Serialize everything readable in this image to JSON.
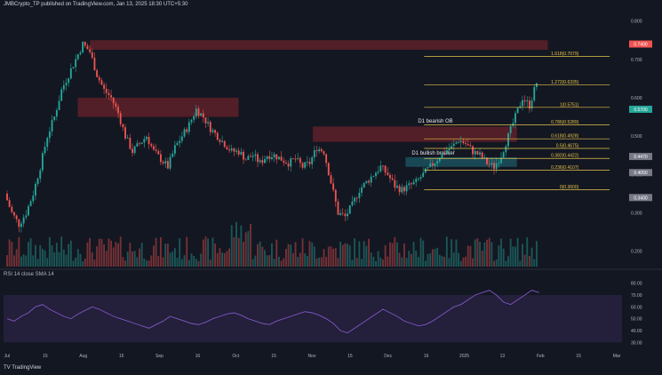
{
  "header": {
    "publisher": "JMBCrypto_TP published on TradingView.com, Jan 13, 2025 18:30 UTC+5:30",
    "line2": "RSI 14 close SMA 14"
  },
  "footer": {
    "logo_text": "TV TradingView"
  },
  "colors": {
    "bg": "#131722",
    "up": "#26a69a",
    "down": "#ef5350",
    "bear_zone": "#5a1f28",
    "bull_zone": "#1c4d5a",
    "fib": "#e6c34a",
    "rsi": "#7e57c2",
    "rsi_band": "#241f3a"
  },
  "annotations": {
    "bearish_ob": "D1 bearish OB",
    "bullish_breaker": "D1 bullish breaker"
  },
  "fib_levels": [
    {
      "label": "1.618(0.7079)",
      "price": 0.708
    },
    {
      "label": "1.272(0.6335)",
      "price": 0.634
    },
    {
      "label": "1(0.5751)",
      "price": 0.575
    },
    {
      "label": "0.786(0.5289)",
      "price": 0.529
    },
    {
      "label": "0.618(0.4928)",
      "price": 0.493
    },
    {
      "label": "0.5(0.4675)",
      "price": 0.468
    },
    {
      "label": "0.382(0.4422)",
      "price": 0.442
    },
    {
      "label": "0.236(0.4107)",
      "price": 0.411
    },
    {
      "label": "0(0.3600)",
      "price": 0.36
    }
  ],
  "price_tags": [
    {
      "price": 0.74,
      "text": "0.7400",
      "color": "#ef5350"
    },
    {
      "price": 0.57,
      "text": "0.5700",
      "color": "#26a69a"
    },
    {
      "price": 0.447,
      "text": "0.4470",
      "color": "#787b86"
    },
    {
      "price": 0.405,
      "text": "0.4050",
      "color": "#787b86"
    },
    {
      "price": 0.34,
      "text": "0.3400",
      "color": "#787b86"
    }
  ],
  "chart_data": [
    {
      "type": "candlestick",
      "title": "",
      "x_ticks": [
        "Jul",
        "15",
        "Aug",
        "15",
        "Sep",
        "16",
        "Oct",
        "15",
        "Nov",
        "15",
        "Dec",
        "16",
        "2025",
        "13",
        "Feb",
        "15",
        "Mar"
      ],
      "y_ticks": [
        "0.800",
        "0.700",
        "0.600",
        "0.500",
        "0.400",
        "0.300",
        "0.200"
      ],
      "ylim": [
        0.16,
        0.82
      ],
      "price_path": [
        0.35,
        0.3,
        0.27,
        0.3,
        0.35,
        0.42,
        0.5,
        0.55,
        0.62,
        0.66,
        0.7,
        0.74,
        0.72,
        0.66,
        0.62,
        0.6,
        0.56,
        0.5,
        0.46,
        0.48,
        0.5,
        0.46,
        0.44,
        0.42,
        0.47,
        0.5,
        0.53,
        0.57,
        0.55,
        0.52,
        0.5,
        0.48,
        0.46,
        0.46,
        0.44,
        0.45,
        0.43,
        0.45,
        0.45,
        0.44,
        0.43,
        0.44,
        0.42,
        0.43,
        0.47,
        0.46,
        0.38,
        0.3,
        0.29,
        0.32,
        0.36,
        0.38,
        0.4,
        0.42,
        0.4,
        0.37,
        0.36,
        0.37,
        0.38,
        0.4,
        0.42,
        0.44,
        0.46,
        0.47,
        0.49,
        0.48,
        0.46,
        0.45,
        0.43,
        0.42,
        0.45,
        0.5,
        0.55,
        0.6,
        0.58,
        0.64
      ],
      "zones": [
        {
          "name": "bear-zone-top",
          "kind": "bear",
          "x_from": 0.14,
          "x_to": 0.88,
          "p_low": 0.725,
          "p_high": 0.75
        },
        {
          "name": "bear-zone-mid",
          "kind": "bear",
          "x_from": 0.12,
          "x_to": 0.38,
          "p_low": 0.55,
          "p_high": 0.6
        },
        {
          "name": "bear-zone-ob",
          "kind": "bear",
          "x_from": 0.5,
          "x_to": 0.83,
          "p_low": 0.485,
          "p_high": 0.525
        },
        {
          "name": "bull-zone-breaker",
          "kind": "bull",
          "x_from": 0.65,
          "x_to": 0.83,
          "p_low": 0.42,
          "p_high": 0.445
        }
      ]
    },
    {
      "type": "line",
      "title": "",
      "series": [
        {
          "values": [
            50,
            48,
            52,
            55,
            60,
            62,
            58,
            55,
            52,
            50,
            54,
            57,
            60,
            58,
            55,
            52,
            50,
            48,
            46,
            44,
            42,
            45,
            48,
            52,
            50,
            48,
            46,
            45,
            47,
            50,
            52,
            54,
            55,
            53,
            50,
            48,
            46,
            45,
            48,
            50,
            52,
            54,
            56,
            55,
            53,
            50,
            46,
            40,
            38,
            42,
            46,
            50,
            54,
            58,
            55,
            52,
            48,
            46,
            44,
            45,
            48,
            52,
            56,
            60,
            62,
            66,
            70,
            72,
            74,
            70,
            64,
            62,
            66,
            70,
            74,
            72
          ]
        }
      ],
      "y_ticks": [
        "80.00",
        "70.00",
        "60.00",
        "50.00",
        "40.00",
        "30.00"
      ],
      "ylim": [
        25,
        85
      ],
      "band": [
        30,
        70
      ]
    }
  ]
}
